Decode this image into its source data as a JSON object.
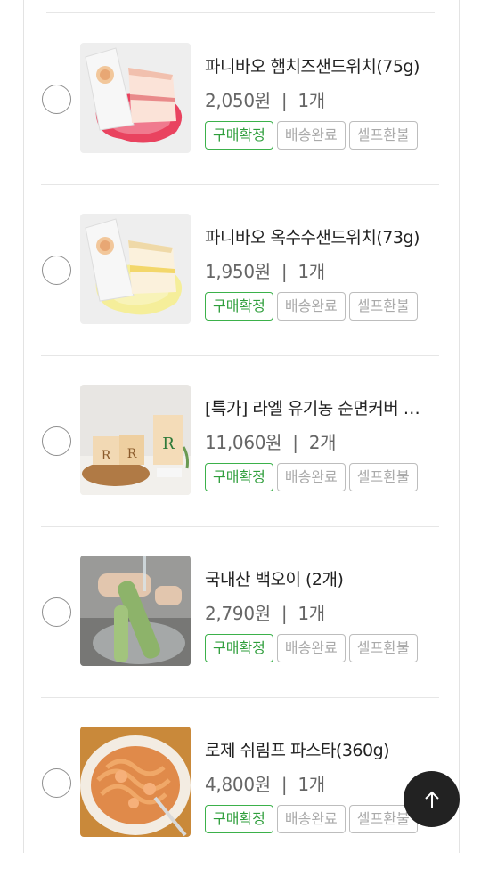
{
  "items": [
    {
      "name": "파니바오 햄치즈샌드위치(75g)",
      "price": "2,050원",
      "qty": "1개",
      "thumb_icon": "ham-cheese-sandwich-image"
    },
    {
      "name": "파니바오 옥수수샌드위치(73g)",
      "price": "1,950원",
      "qty": "1개",
      "thumb_icon": "corn-sandwich-image"
    },
    {
      "name": "[특가] 라엘 유기농 순면커버 초슬림 중형 생리대",
      "price": "11,060원",
      "qty": "2개",
      "thumb_icon": "sanitary-pad-boxes-image"
    },
    {
      "name": "국내산 백오이 (2개)",
      "price": "2,790원",
      "qty": "1개",
      "thumb_icon": "cucumber-image"
    },
    {
      "name": "로제 쉬림프 파스타(360g)",
      "price": "4,800원",
      "qty": "1개",
      "thumb_icon": "rose-shrimp-pasta-image"
    }
  ],
  "tags": {
    "confirm": "구매확정",
    "delivered": "배송완료",
    "refund": "셀프환불"
  },
  "separator": "|",
  "colors": {
    "accent_green": "#3bb14a",
    "top_button": "#222222"
  },
  "scroll_top_icon": "arrow-up-icon"
}
